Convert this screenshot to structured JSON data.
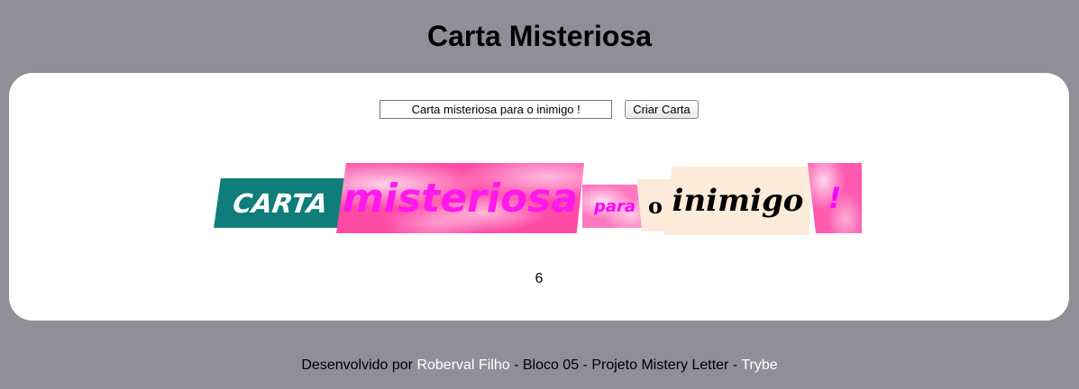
{
  "header": {
    "title": "Carta Misteriosa"
  },
  "controls": {
    "input_value": "Carta misteriosa para o inimigo !",
    "create_button_label": "Criar Carta"
  },
  "letter": {
    "words": [
      "CARTA",
      "misteriosa",
      "para",
      "o",
      "inimigo",
      "!"
    ]
  },
  "counter": {
    "value": "6"
  },
  "footer": {
    "prefix": "Desenvolvido por",
    "author": "Roberval Filho",
    "middle": "- Bloco 05 - Projeto Mistery Letter -",
    "brand": "Trybe"
  },
  "colors": {
    "background": "#908f97",
    "panel": "#ffffff",
    "teal": "#0f7d7a",
    "pink": "#ff4aa6",
    "magenta_text": "#ff18ee",
    "cream": "#fbebd8",
    "footer_link": "#ffffff"
  }
}
